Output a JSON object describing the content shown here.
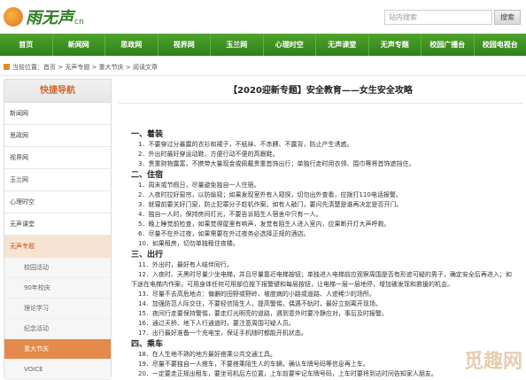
{
  "logo": {
    "text": "雨无声",
    "sub": "cn"
  },
  "search": {
    "placeholder": "站内搜索",
    "button": "搜索"
  },
  "nav": [
    "首页",
    "新闻网",
    "思政网",
    "视界网",
    "玉兰网",
    "心理时空",
    "无声课堂",
    "无声专题",
    "校园广播台",
    "校园电视台"
  ],
  "breadcrumb": {
    "prefix": "当前位置：",
    "items": [
      "首页",
      "无声专题",
      "重大节庆",
      "阅读文章"
    ],
    "sep": " > "
  },
  "sidebar": {
    "title": "快捷导航",
    "items": [
      {
        "label": "新闻网",
        "type": "item"
      },
      {
        "label": "思政网",
        "type": "item"
      },
      {
        "label": "视界网",
        "type": "item"
      },
      {
        "label": "玉兰网",
        "type": "item"
      },
      {
        "label": "心理时空",
        "type": "item"
      },
      {
        "label": "无声课堂",
        "type": "item"
      },
      {
        "label": "无声专题",
        "type": "item-active"
      },
      {
        "label": "校园活动",
        "type": "sub"
      },
      {
        "label": "90年校庆",
        "type": "sub"
      },
      {
        "label": "理论学习",
        "type": "sub"
      },
      {
        "label": "纪念活动",
        "type": "sub"
      },
      {
        "label": "重大节庆",
        "type": "sub-active"
      },
      {
        "label": "VOICE",
        "type": "sub"
      }
    ]
  },
  "article": {
    "title": "【2020迎新专题】安全教育——女生安全攻略",
    "sections": [
      {
        "head": "一、着装",
        "lines": [
          "1．不要穿过分暴露的衣衫和裙子，不纸袜、不赤膊、不露背，防止产生诱惑。",
          "2．外出时最好穿运动鞋，方便行动不便的高跟鞋。",
          "3．贵重财物露富，不携带大量现金或佩戴贵重首饰出行；单独行走时用衣领、围巾等将首饰遮挡住。"
        ]
      },
      {
        "head": "二、住宿",
        "lines": [
          "1．周末或节假日，尽量避免独自一人住宿。",
          "2．入夜时拉好窗帘，以防偷窥；如果发现室外有人窥探，切勿出外查看，应拨打110电话报警。",
          "3．就寝前要关好门窗，防止犯罪分子趁机作案。如有人敲门，要问先清楚是谁再决定是否开门。",
          "4．独自一人时，保持房间灯光，不要告诉陌生人宿舍中只有一人。",
          "5．晚上睡觉前检查，如果觉得屋里有响声，发觉有陌生人进入室内，应果断开灯大声呼救。",
          "6．尽量不在外过夜，如果需要在外过夜务必选择正规的酒店。",
          "10．如果租房，切勿单独租住夜楼。"
        ]
      },
      {
        "head": "三、出行",
        "lines": [
          "11．外出时，最好有人结伴同行。",
          "12．入夜时、天黑时尽量少坐电梯，并且尽量靠近电梯按钮；单独进入电梯前应观察周围是否有形迹可疑的男子，确定安全后再进入；如下途在电梯内作案，可用身体任何可用部位按下报警键和每层按钮，让电梯一层一层地停，增加被发现和救援的机会。",
          "13．尽量不去高危地点：偏僻的田野或野岭、坡度病的小路或道路、人迹稀少的场所。",
          "14．加强防范人际交往，不要轻信陌生人，提高警惕，偶遇不轨时，最好立刻离开现场。",
          "15．夜间行走要保持警惕，要走灯光明亮的道路，遇到意外时要冷静应对，事后及时报警。",
          "16．通过天桥、地下人行通道时，要注意周围可疑人员。",
          "17．出行最好准备一个充电宝，保证手机随时都能开机状态。"
        ]
      },
      {
        "head": "四、乘车",
        "lines": [
          "18．在人生地不熟的地方最好搭乘公共交通工具。",
          "19．尽量不要独自一人搭车，不要搭乘陌生人的车辆，确认车牌号码等信息再上车。",
          "20．一定要走正规出租车，要坐司机后方位置，上车前要牢记车牌号码，上车时要将到达时间告知家人朋友。"
        ]
      }
    ]
  },
  "watermark": "觅趣网"
}
